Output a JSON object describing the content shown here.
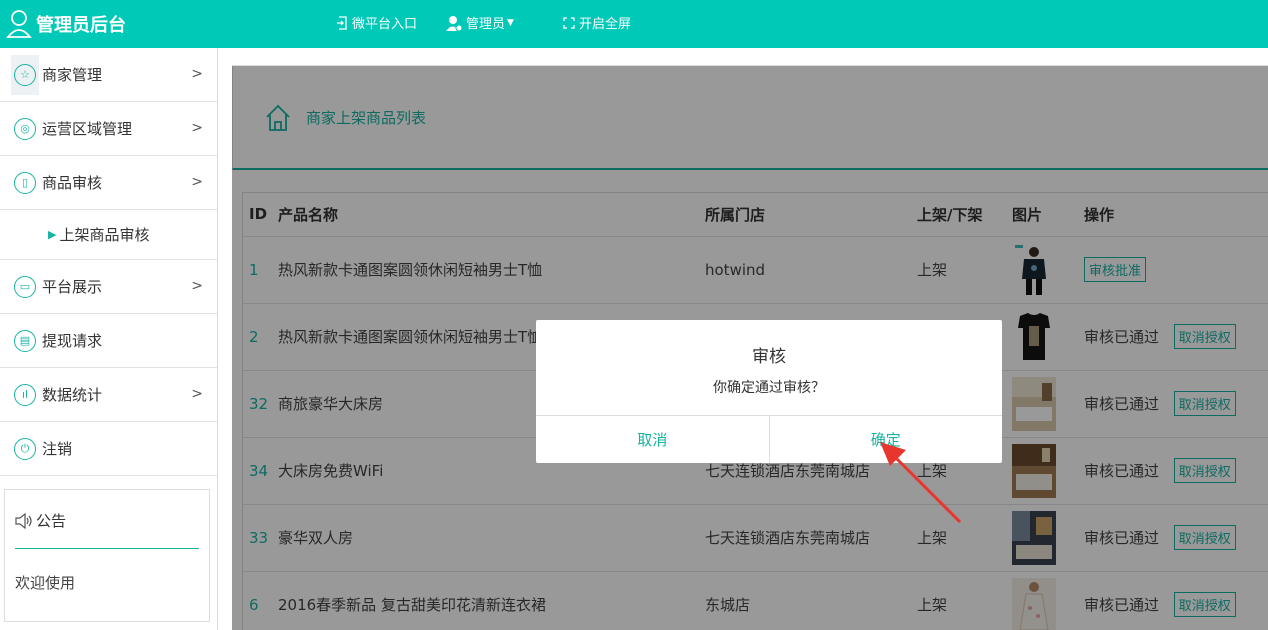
{
  "app": {
    "title": "管理员后台",
    "accent": "#00c9b7"
  },
  "topnav": {
    "micro_platform": "微平台入口",
    "admin": "管理员",
    "fullscreen": "开启全屏"
  },
  "sidebar": {
    "items": [
      {
        "label": "商家管理",
        "icon": "star-icon"
      },
      {
        "label": "运营区域管理",
        "icon": "location-icon"
      },
      {
        "label": "商品审核",
        "icon": "clipboard-icon"
      },
      {
        "label": "平台展示",
        "icon": "display-icon"
      },
      {
        "label": "提现请求",
        "icon": "wallet-icon"
      },
      {
        "label": "数据统计",
        "icon": "chart-icon"
      },
      {
        "label": "注销",
        "icon": "power-icon"
      }
    ],
    "sub_item": "上架商品审核",
    "notice": {
      "title": "公告",
      "body": "欢迎使用"
    }
  },
  "main": {
    "page_title": "商家上架商品列表",
    "table": {
      "headers": [
        "ID",
        "产品名称",
        "所属门店",
        "上架/下架",
        "图片",
        "操作"
      ],
      "rows": [
        {
          "id": "1",
          "name": "热风新款卡通图案圆领休闲短袖男士T恤",
          "store": "hotwind",
          "shelf": "上架",
          "status": "",
          "action": "审核批准"
        },
        {
          "id": "2",
          "name": "热风新款卡通图案圆领休闲短袖男士T恤",
          "store": "",
          "shelf": "",
          "status": "审核已通过",
          "action": "取消授权"
        },
        {
          "id": "32",
          "name": "商旅豪华大床房",
          "store": "",
          "shelf": "",
          "status": "审核已通过",
          "action": "取消授权"
        },
        {
          "id": "34",
          "name": "大床房免费WiFi",
          "store": "七天连锁酒店东莞南城店",
          "shelf": "上架",
          "status": "审核已通过",
          "action": "取消授权"
        },
        {
          "id": "33",
          "name": "豪华双人房",
          "store": "七天连锁酒店东莞南城店",
          "shelf": "上架",
          "status": "审核已通过",
          "action": "取消授权"
        },
        {
          "id": "6",
          "name": "2016春季新品 复古甜美印花清新连衣裙",
          "store": "东城店",
          "shelf": "上架",
          "status": "审核已通过",
          "action": "取消授权"
        }
      ]
    }
  },
  "modal": {
    "title": "审核",
    "message": "你确定通过审核？",
    "cancel": "取消",
    "confirm": "确定"
  }
}
